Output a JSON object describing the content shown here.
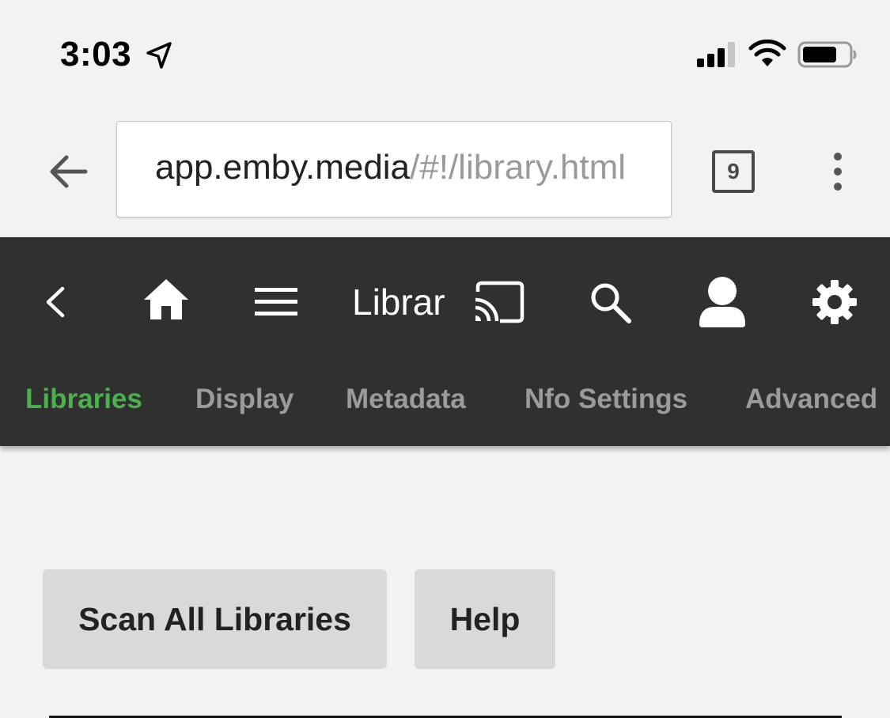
{
  "status_bar": {
    "time": "3:03",
    "icons": [
      "location-arrow-icon",
      "cellular-signal-icon",
      "wifi-icon",
      "battery-icon"
    ]
  },
  "browser": {
    "url_host": "app.emby.media",
    "url_path": "/#!/library.html",
    "tab_count": "9",
    "icons": [
      "back-arrow-icon",
      "more-vert-icon"
    ]
  },
  "header": {
    "title": "Library",
    "icons": [
      "chevron-left-icon",
      "home-icon",
      "menu-icon",
      "cast-icon",
      "search-icon",
      "user-icon",
      "gear-icon"
    ],
    "tabs": [
      {
        "label": "Libraries",
        "active": true
      },
      {
        "label": "Display",
        "active": false
      },
      {
        "label": "Metadata",
        "active": false
      },
      {
        "label": "Nfo Settings",
        "active": false
      },
      {
        "label": "Advanced",
        "active": false
      }
    ],
    "colors": {
      "background": "#303030",
      "active_tab": "#4caf50",
      "inactive_tab": "#9b9b9b"
    }
  },
  "content": {
    "scan_button": "Scan All Libraries",
    "help_button": "Help"
  }
}
